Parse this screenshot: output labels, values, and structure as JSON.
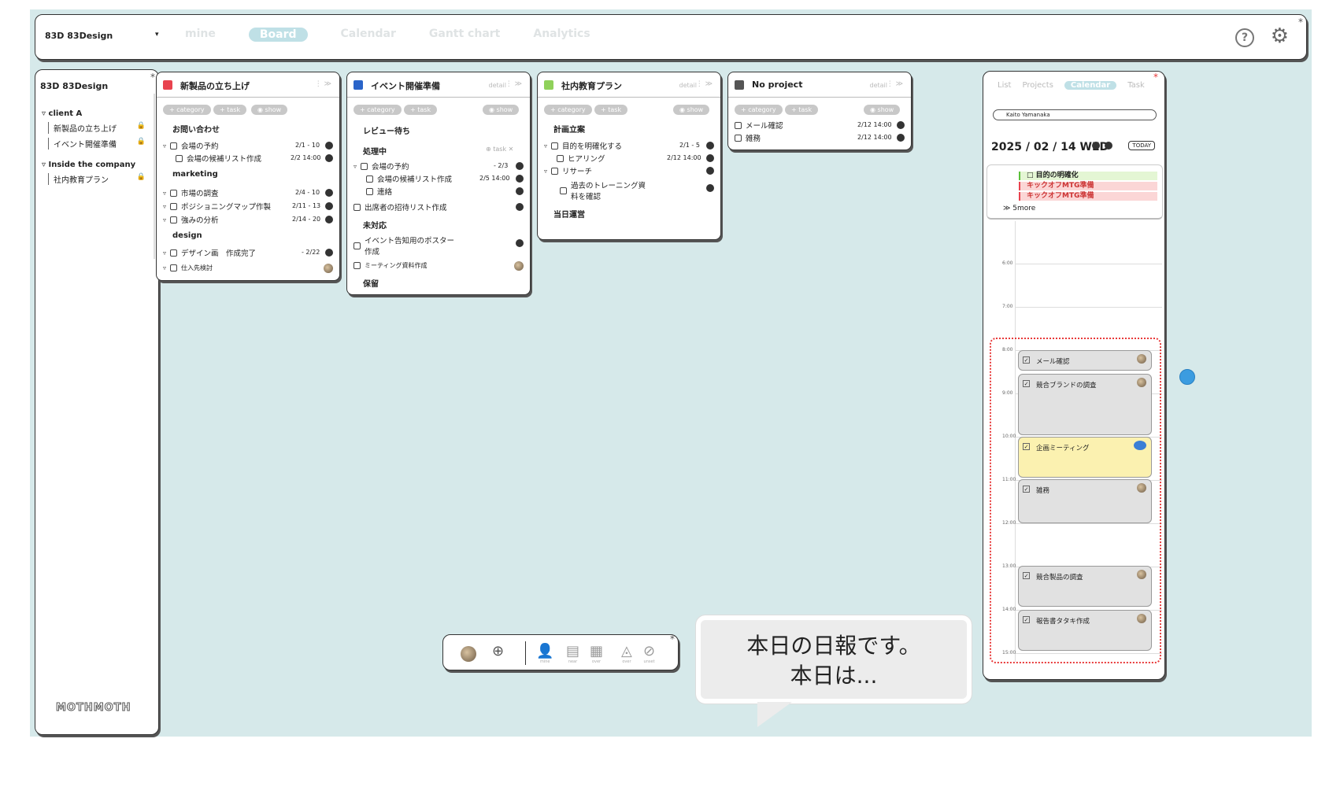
{
  "topbar": {
    "brand": "83D 83Design",
    "nav": [
      "mine",
      "Board",
      "Calendar",
      "Gantt chart",
      "Analytics"
    ],
    "active_nav": "Board",
    "help": "?"
  },
  "sidebar": {
    "brand": "83D 83Design",
    "groups": [
      {
        "label": "client A",
        "items": [
          "新製品の立ち上げ",
          "イベント開催準備"
        ]
      },
      {
        "label": "Inside the company",
        "items": [
          "社内教育プラン"
        ]
      }
    ],
    "logo": "MOTHMOTH"
  },
  "columns": [
    {
      "title": "新製品の立ち上げ",
      "color": "#e8434f",
      "chips": [
        "+ category",
        "+ task",
        "show"
      ],
      "sections": [
        "お問い合わせ",
        "marketing",
        "design"
      ],
      "tasks": [
        {
          "label": "会場の予約",
          "date": "2/1 - 10"
        },
        {
          "label": "会場の候補リスト作成",
          "date": "2/2 14:00"
        },
        {
          "label": "市場の調査",
          "date": "2/4 - 10"
        },
        {
          "label": "ポジショニングマップ作製",
          "date": "2/11 - 13"
        },
        {
          "label": "強みの分析",
          "date": "2/14 - 20"
        },
        {
          "label": "デザイン画　作成完了",
          "date": "- 2/22"
        },
        {
          "label": "仕入先検討",
          "date": ""
        }
      ]
    },
    {
      "title": "イベント開催準備",
      "color": "#2a64c9",
      "detail": "detail",
      "chips": [
        "+ category",
        "+ task",
        "show"
      ],
      "sections": [
        "レビュー待ち",
        "処理中",
        "未対応",
        "保留"
      ],
      "task_btn": "task",
      "tasks": [
        {
          "label": "会場の予約",
          "date": "- 2/3"
        },
        {
          "label": "会場の候補リスト作成",
          "date": "2/5 14:00"
        },
        {
          "label": "連絡",
          "date": ""
        },
        {
          "label": "出席者の招待リスト作成",
          "date": ""
        },
        {
          "label": "イベント告知用のポスター作成",
          "date": ""
        },
        {
          "label": "ミーティング資料作成",
          "date": ""
        }
      ]
    },
    {
      "title": "社内教育プラン",
      "color": "#8fd15a",
      "detail": "detail",
      "chips": [
        "+ category",
        "+ task",
        "show"
      ],
      "sections": [
        "計画立案",
        "当日運営"
      ],
      "tasks": [
        {
          "label": "目的を明確化する",
          "date": "2/1 - 5"
        },
        {
          "label": "ヒアリング",
          "date": "2/12 14:00"
        },
        {
          "label": "リサーチ",
          "date": ""
        },
        {
          "label": "過去のトレーニング資料を確認",
          "date": ""
        }
      ]
    },
    {
      "title": "No project",
      "color": "#555555",
      "detail": "detail",
      "chips": [
        "+ category",
        "+ task",
        "show"
      ],
      "tasks": [
        {
          "label": "メール確認",
          "date": "2/12 14:00"
        },
        {
          "label": "雑務",
          "date": "2/12 14:00"
        }
      ]
    }
  ],
  "calendar": {
    "tabs": [
      "List",
      "Projects",
      "Calendar",
      "Task"
    ],
    "active_tab": "Calendar",
    "user": "Kaito Yamanaka",
    "date": "2025 / 02 / 14 WED",
    "today": "TODAY",
    "allday": [
      "目的の明確化",
      "キックオフMTG準備",
      "キックオフMTG準備"
    ],
    "more": "5more",
    "hours": [
      "6:00",
      "7:00",
      "8:00",
      "9:00",
      "10:00",
      "11:00",
      "12:00",
      "13:00",
      "14:00",
      "15:00"
    ],
    "events": [
      "メール確認",
      "競合ブランドの調査",
      "企画ミーティング",
      "雑務",
      "競合製品の調査",
      "報告書タタキ作成"
    ]
  },
  "dock": {
    "labels": [
      "mine",
      "near",
      "over",
      "over",
      "unset"
    ]
  },
  "bubble": {
    "line1": "本日の日報です。",
    "line2": "本日は..."
  },
  "colors": {
    "bg": "#d6e9ea",
    "accent": "#bfe0e6",
    "dot": "#3b9ce0"
  }
}
